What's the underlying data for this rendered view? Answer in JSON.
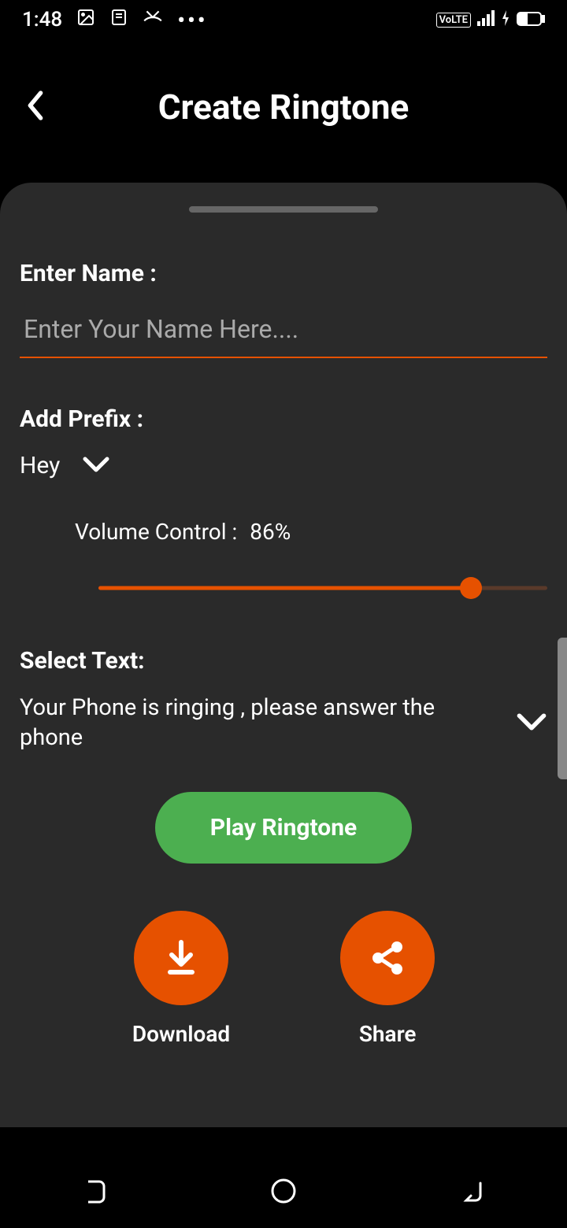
{
  "statusBar": {
    "time": "1:48",
    "volte": "VoLTE"
  },
  "header": {
    "title": "Create Ringtone"
  },
  "form": {
    "nameLabel": "Enter Name :",
    "namePlaceholder": "Enter Your Name Here....",
    "prefixLabel": "Add Prefix :",
    "prefixValue": "Hey",
    "volumeLabel": "Volume Control :",
    "volumeValue": "86%",
    "volumePercent": 86,
    "selectTextLabel": "Select Text:",
    "selectTextValue": "Your Phone is ringing , please answer the phone",
    "playButton": "Play Ringtone",
    "downloadLabel": "Download",
    "shareLabel": "Share"
  }
}
